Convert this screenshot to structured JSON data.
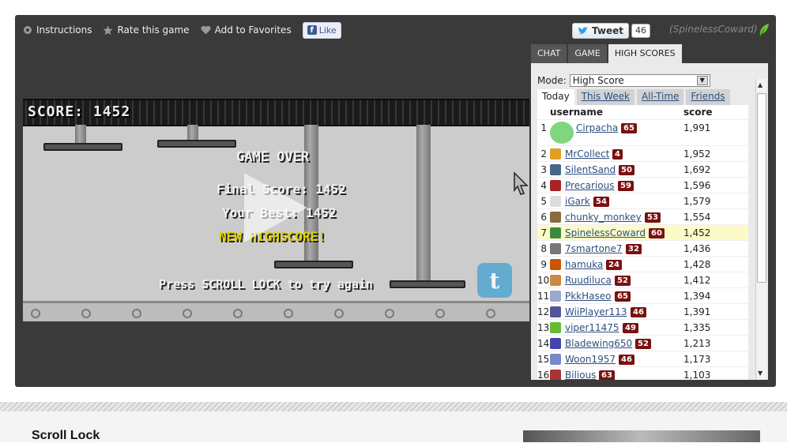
{
  "toolbar": {
    "instructions": "Instructions",
    "rate": "Rate this game",
    "favorites": "Add to Favorites",
    "like": "Like"
  },
  "social": {
    "tweet": "Tweet",
    "tweet_count": "46",
    "current_user": "(SpinelessCoward)"
  },
  "game": {
    "score_hud": "SCORE: 1452",
    "game_over": "GAME OVER",
    "final_score": "Final Score: 1452",
    "your_best": "Your Best: 1452",
    "new_highscore": "NEW HIGHSCORE!",
    "retry_hint": "Press SCROLL LOCK to try again"
  },
  "tabs": [
    "CHAT",
    "GAME",
    "HIGH SCORES"
  ],
  "scores": {
    "mode_label": "Mode:",
    "mode_value": "High Score",
    "subtabs": [
      "Today",
      "This Week",
      "All-Time",
      "Friends"
    ],
    "col_username": "username",
    "col_score": "score",
    "rows": [
      {
        "rank": "1",
        "user": "Cirpacha",
        "level": "65",
        "score": "1,991",
        "color": "#7fd67f"
      },
      {
        "rank": "2",
        "user": "MrCollect",
        "level": "4",
        "score": "1,952",
        "color": "#e0a020"
      },
      {
        "rank": "3",
        "user": "SilentSand",
        "level": "50",
        "score": "1,692",
        "color": "#446688"
      },
      {
        "rank": "4",
        "user": "Precarious",
        "level": "59",
        "score": "1,596",
        "color": "#aa2222"
      },
      {
        "rank": "5",
        "user": "iGark",
        "level": "54",
        "score": "1,579",
        "color": "#dddddd"
      },
      {
        "rank": "6",
        "user": "chunky_monkey",
        "level": "53",
        "score": "1,554",
        "color": "#8a6a40"
      },
      {
        "rank": "7",
        "user": "SpinelessCoward",
        "level": "60",
        "score": "1,452",
        "color": "#3a8a3a"
      },
      {
        "rank": "8",
        "user": "7smartone7",
        "level": "32",
        "score": "1,436",
        "color": "#777777"
      },
      {
        "rank": "9",
        "user": "hamuka",
        "level": "24",
        "score": "1,428",
        "color": "#cc5500"
      },
      {
        "rank": "10",
        "user": "Ruudiluca",
        "level": "52",
        "score": "1,412",
        "color": "#cc8844"
      },
      {
        "rank": "11",
        "user": "PkkHaseo",
        "level": "65",
        "score": "1,394",
        "color": "#99aacc"
      },
      {
        "rank": "12",
        "user": "WiiPlayer113",
        "level": "46",
        "score": "1,391",
        "color": "#555599"
      },
      {
        "rank": "13",
        "user": "viper11475",
        "level": "49",
        "score": "1,335",
        "color": "#66bb33"
      },
      {
        "rank": "14",
        "user": "Bladewing650",
        "level": "52",
        "score": "1,213",
        "color": "#4444aa"
      },
      {
        "rank": "15",
        "user": "Woon1957",
        "level": "46",
        "score": "1,173",
        "color": "#7788cc"
      },
      {
        "rank": "16",
        "user": "Bilious",
        "level": "63",
        "score": "1,103",
        "color": "#aa3333"
      }
    ]
  },
  "page": {
    "game_title": "Scroll Lock"
  }
}
